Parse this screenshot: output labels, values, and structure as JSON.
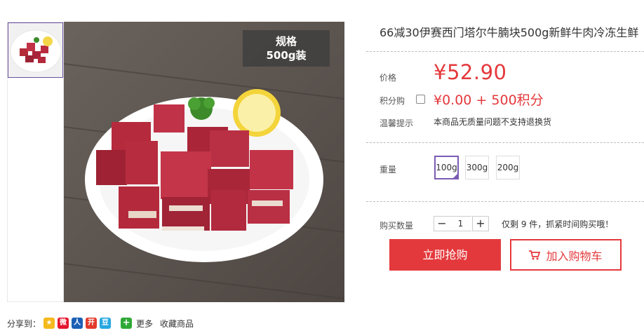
{
  "product": {
    "title": "66减30伊赛西门塔尔牛腩块500g新鲜牛肉冷冻生鲜",
    "spec_tag_line1": "规格",
    "spec_tag_line2": "500g装"
  },
  "price": {
    "label": "价格",
    "value": "¥52.90"
  },
  "points": {
    "label": "积分购",
    "value": "¥0.00 + 500积分",
    "checked": false
  },
  "tip": {
    "label": "温馨提示",
    "text": "本商品无质量问题不支持退换货"
  },
  "weight": {
    "label": "重量",
    "options": [
      "100g",
      "300g",
      "200g"
    ],
    "selected": "100g"
  },
  "quantity": {
    "label": "购买数量",
    "minus": "−",
    "value": "1",
    "plus": "+",
    "stock_text": "仅剩 9 件，抓紧时间购买哦！"
  },
  "actions": {
    "buy_now": "立即抢购",
    "add_to_cart": "加入购物车"
  },
  "share": {
    "label": "分享到：",
    "more": "更多",
    "favorite": "收藏商品",
    "icons": [
      "qzone-icon",
      "weibo-icon",
      "renren-icon",
      "kaixin-icon",
      "douban-icon"
    ]
  },
  "colors": {
    "accent_red": "#e4393c",
    "selected_purple": "#7a5bb5"
  }
}
